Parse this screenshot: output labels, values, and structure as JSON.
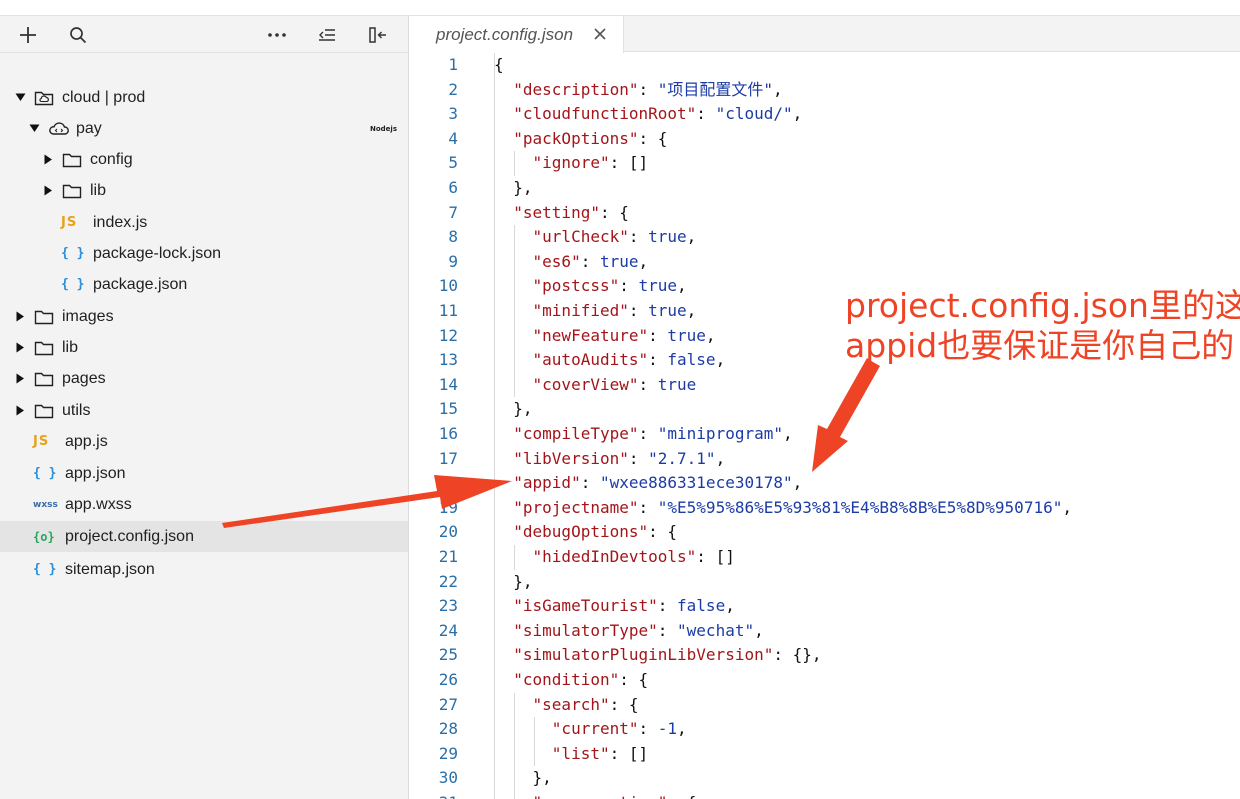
{
  "sidebar": {
    "toolbar": {
      "add_icon": "plus-icon",
      "search_icon": "search-icon",
      "more_icon": "more-icon",
      "collapse_icon": "outdent-icon",
      "layout_icon": "panel-left-icon"
    },
    "tree": [
      {
        "label": "cloud | prod",
        "icon": "cloud-folder-icon",
        "expanded": true
      },
      {
        "label": "pay",
        "icon": "cloud-function-icon",
        "expanded": true,
        "badge": "Nodejs"
      },
      {
        "label": "config",
        "icon": "folder-icon",
        "expanded": false
      },
      {
        "label": "lib",
        "icon": "folder-icon",
        "expanded": false
      },
      {
        "label": "index.js",
        "icon": "js-file-icon",
        "glyph": "JS"
      },
      {
        "label": "package-lock.json",
        "icon": "json-file-icon",
        "glyph": "{ }"
      },
      {
        "label": "package.json",
        "icon": "json-file-icon",
        "glyph": "{ }"
      },
      {
        "label": "images",
        "icon": "folder-icon",
        "expanded": false
      },
      {
        "label": "lib",
        "icon": "folder-icon",
        "expanded": false
      },
      {
        "label": "pages",
        "icon": "folder-icon",
        "expanded": false
      },
      {
        "label": "utils",
        "icon": "folder-icon",
        "expanded": false
      },
      {
        "label": "app.js",
        "icon": "js-file-icon",
        "glyph": "JS"
      },
      {
        "label": "app.json",
        "icon": "json-file-icon",
        "glyph": "{ }"
      },
      {
        "label": "app.wxss",
        "icon": "wxss-file-icon",
        "glyph": "wxss"
      },
      {
        "label": "project.config.json",
        "icon": "config-file-icon",
        "glyph": "{o}",
        "selected": true
      },
      {
        "label": "sitemap.json",
        "icon": "json-file-icon",
        "glyph": "{ }"
      }
    ]
  },
  "editor": {
    "tab": {
      "label": "project.config.json",
      "close_icon": "close-icon"
    },
    "lines": [
      "{",
      "  \"description\": \"项目配置文件\",",
      "  \"cloudfunctionRoot\": \"cloud/\",",
      "  \"packOptions\": {",
      "    \"ignore\": []",
      "  },",
      "  \"setting\": {",
      "    \"urlCheck\": true,",
      "    \"es6\": true,",
      "    \"postcss\": true,",
      "    \"minified\": true,",
      "    \"newFeature\": true,",
      "    \"autoAudits\": false,",
      "    \"coverView\": true",
      "  },",
      "  \"compileType\": \"miniprogram\",",
      "  \"libVersion\": \"2.7.1\",",
      "  \"appid\": \"wxee886331ece30178\",",
      "  \"projectname\": \"%E5%95%86%E5%93%81%E4%B8%8B%E5%8D%950716\",",
      "  \"debugOptions\": {",
      "    \"hidedInDevtools\": []",
      "  },",
      "  \"isGameTourist\": false,",
      "  \"simulatorType\": \"wechat\",",
      "  \"simulatorPluginLibVersion\": {},",
      "  \"condition\": {",
      "    \"search\": {",
      "      \"current\": -1,",
      "      \"list\": []",
      "    },",
      "    \"conversation\": {"
    ]
  },
  "annotation": {
    "line1": "project.config.json里的这个",
    "line2": "appid也要保证是你自己的",
    "color": "#ef4325"
  }
}
